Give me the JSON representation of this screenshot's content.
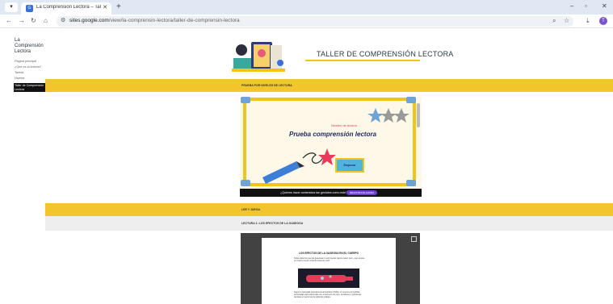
{
  "browser": {
    "tab_title": "La Comprensión Lectora – Taller…",
    "tab_favicon": "G",
    "url_host": "sites.google.com",
    "url_path": "/view/la-comprensin-lectora/taller-de-comprensin-lectora",
    "profile_letter": "T",
    "icons": [
      "menu-icon",
      "close-icon",
      "new-tab-icon",
      "back-icon",
      "forward-icon",
      "reload-icon",
      "home-icon",
      "site-info-icon",
      "zoom-icon",
      "bookmark-star-icon",
      "download-icon",
      "kebab-menu-icon"
    ]
  },
  "sidebar": {
    "site_title": "La Comprensión Lectora",
    "items": [
      {
        "label": "Página principal"
      },
      {
        "label": "¿Qué es la lectura?"
      },
      {
        "label": "Tareas"
      },
      {
        "label": "Niveles"
      }
    ],
    "active_item": "Taller de Comprensión Lectora"
  },
  "page": {
    "title": "TALLER DE COMPRENSIÓN LECTORA",
    "band1_label": "PRUEBA POR NIVELES DE LECTURA",
    "band2_label": "LEE Y JUEGA",
    "band3_label": "LECTURA 1: LOS EFECTOS DE LA GASEOSA"
  },
  "embed1": {
    "subtitle": "Niveles de lectura",
    "title": "Prueba comprensión lectora",
    "button": "Empezar",
    "banner_text": "¿Quieres hacer contenidos tan geniales como este?",
    "banner_cta": "REGISTRATE AHORA"
  },
  "embed2": {
    "doc_title": "LOS EFECTOS DE LA GASEOSA EN EL CUERPO",
    "para1": "Todos sabemos que las gaseosas no son buenas para la salud, pero ¿qué sucede en nuestro cuerpo cuando bebemos una?",
    "para2": "Según la Sociedad Internacional de Nutrición (ISSN), el consumo de bebidas azucaradas está relacionado con el aumento de peso, la diabetes y problemas dentales en personas de todas las edades."
  },
  "colors": {
    "accent_yellow": "#f3c52c",
    "brand_blue": "#3b6fd8",
    "cta_purple": "#6b3fd1"
  }
}
